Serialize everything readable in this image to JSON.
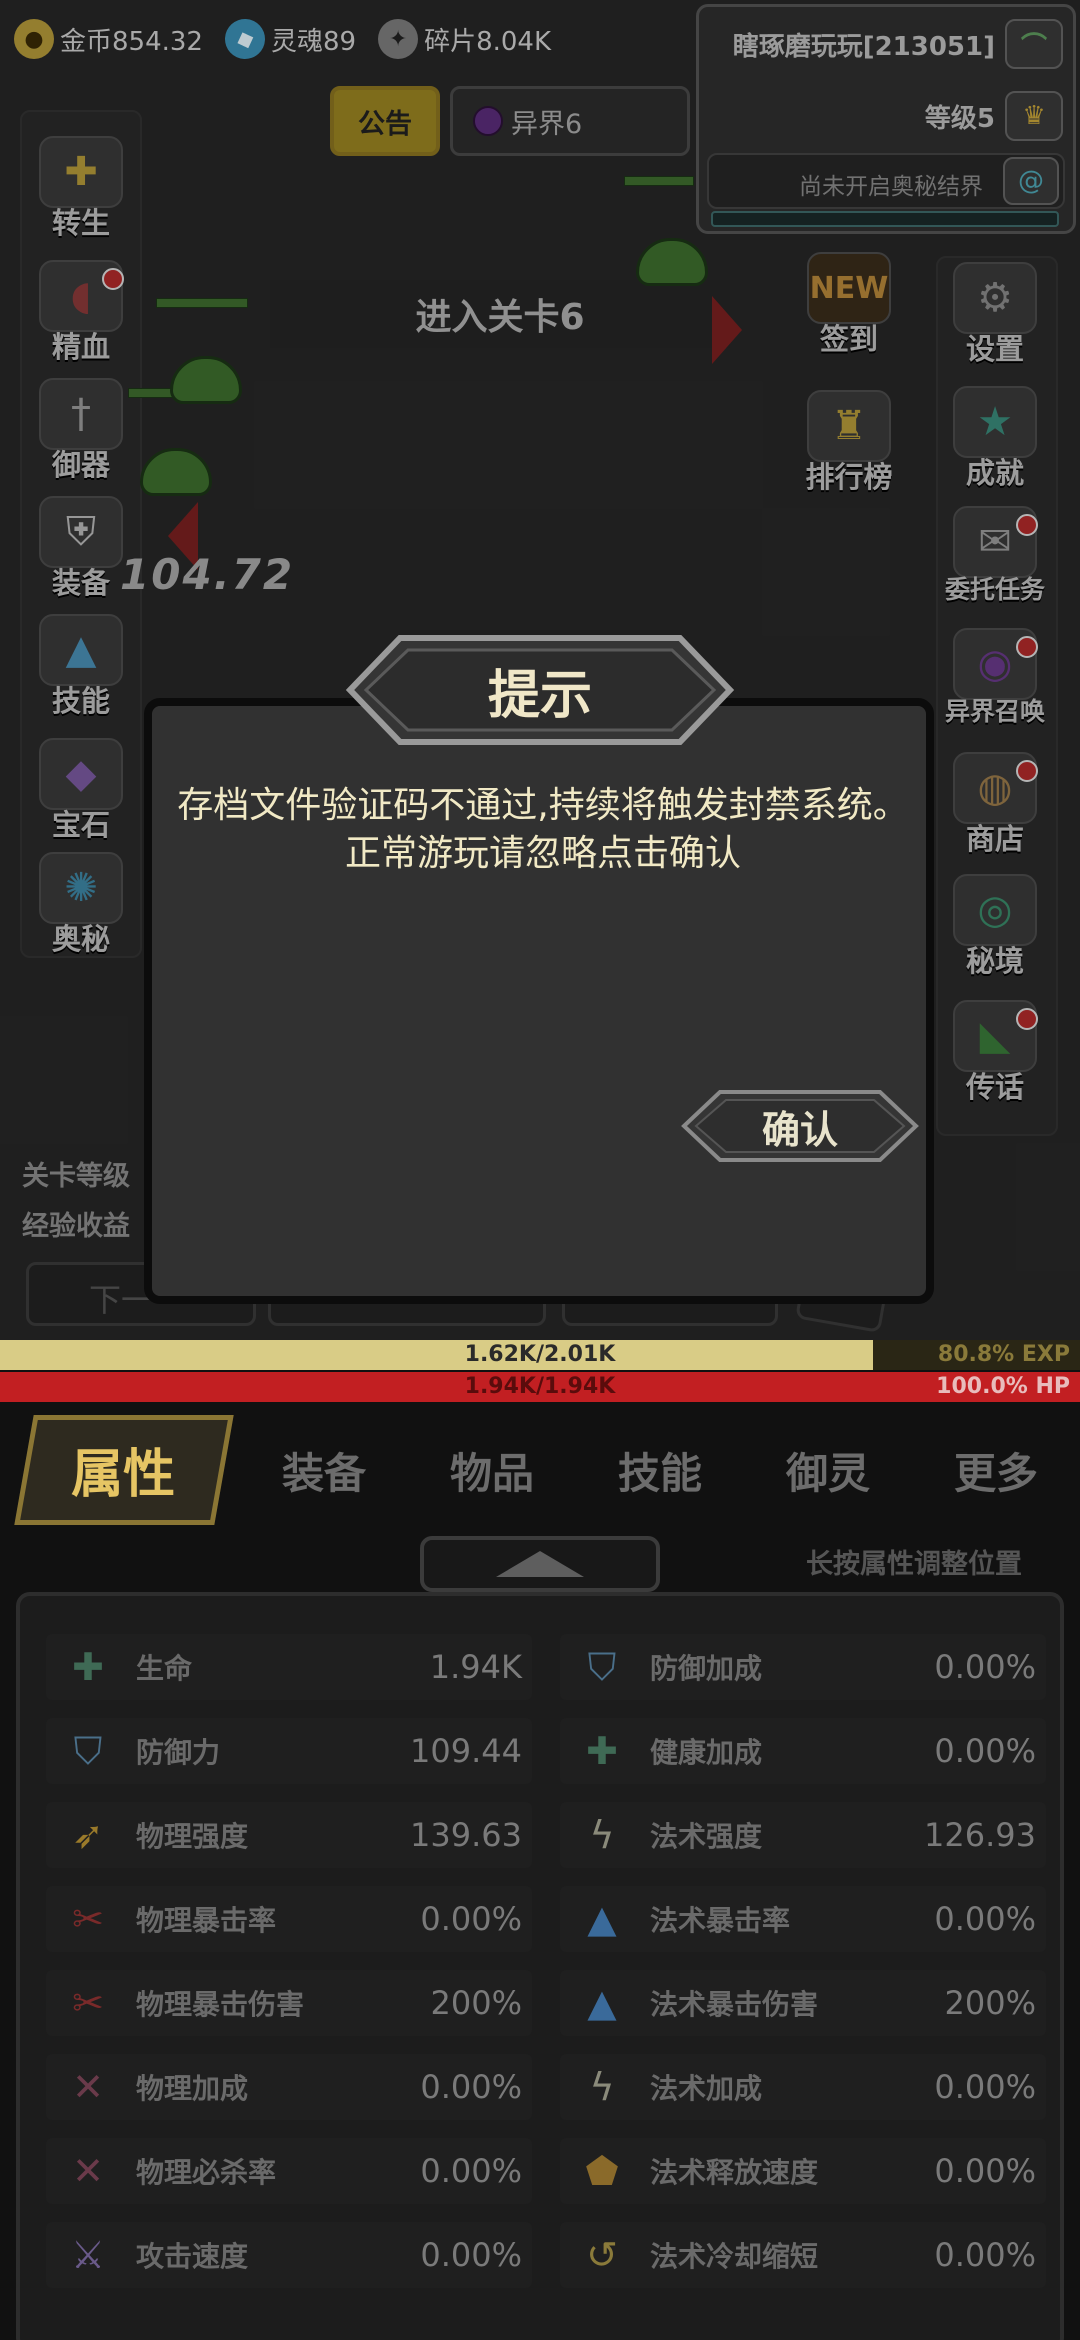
{
  "currencies": {
    "gold": "金币854.32",
    "soul": "灵魂89",
    "fragment": "碎片8.04K"
  },
  "player": {
    "name": "瞎琢磨玩玩[213051]",
    "level": "等级5",
    "secret_status": "尚未开启奥秘结界"
  },
  "top_tabs": {
    "notice": "公告",
    "world": "异界6"
  },
  "left_menu": [
    "转生",
    "精血",
    "御器",
    "装备",
    "技能",
    "宝石",
    "奥秘"
  ],
  "right_menu": [
    "设置",
    "成就",
    "委托任务",
    "异界召唤",
    "商店",
    "秘境",
    "传话"
  ],
  "center_buttons": {
    "sign_in_badge": "NEW",
    "sign_in": "签到",
    "leaderboard": "排行榜"
  },
  "stage": {
    "enter": "进入关卡6",
    "damage_text": "104.72"
  },
  "level_info": {
    "stage_level": "关卡等级",
    "exp_gain": "经验收益"
  },
  "partial_buttons": {
    "next": "下一"
  },
  "dialog": {
    "title": "提示",
    "message": "存档文件验证码不通过,持续将触发封禁系统。正常游玩请忽略点击确认",
    "confirm": "确认"
  },
  "exp_bar": {
    "text": "1.62K/2.01K",
    "percent": "80.8% EXP",
    "fraction": 0.808
  },
  "hp_bar": {
    "text": "1.94K/1.94K",
    "percent": "100.0%  HP",
    "fraction": 1.0
  },
  "bottom_tabs": [
    "属性",
    "装备",
    "物品",
    "技能",
    "御灵",
    "更多"
  ],
  "attr_hint": "长按属性调整位置",
  "attributes": [
    {
      "name": "生命",
      "value": "1.94K",
      "icon": "cross-icon"
    },
    {
      "name": "防御加成",
      "value": "0.00%",
      "icon": "shield-icon"
    },
    {
      "name": "防御力",
      "value": "109.44",
      "icon": "shield-icon"
    },
    {
      "name": "健康加成",
      "value": "0.00%",
      "icon": "cross-icon"
    },
    {
      "name": "物理强度",
      "value": "139.63",
      "icon": "sword-icon"
    },
    {
      "name": "法术强度",
      "value": "126.93",
      "icon": "lightning-icon"
    },
    {
      "name": "物理暴击率",
      "value": "0.00%",
      "icon": "claw-icon"
    },
    {
      "name": "法术暴击率",
      "value": "0.00%",
      "icon": "flame-icon"
    },
    {
      "name": "物理暴击伤害",
      "value": "200%",
      "icon": "claw-icon"
    },
    {
      "name": "法术暴击伤害",
      "value": "200%",
      "icon": "flame-icon"
    },
    {
      "name": "物理加成",
      "value": "0.00%",
      "icon": "cross-blades-icon"
    },
    {
      "name": "法术加成",
      "value": "0.00%",
      "icon": "lightning-icon"
    },
    {
      "name": "物理必杀率",
      "value": "0.00%",
      "icon": "cross-blades-icon"
    },
    {
      "name": "法术释放速度",
      "value": "0.00%",
      "icon": "shield-orange-icon"
    },
    {
      "name": "攻击速度",
      "value": "0.00%",
      "icon": "sword-purple-icon"
    },
    {
      "name": "法术冷却缩短",
      "value": "0.00%",
      "icon": "swirl-icon"
    }
  ],
  "colors": {
    "exp_fill": "#d9cc86",
    "hp_fill": "#c21f22",
    "accent_gold": "#e6c564",
    "dialog_text": "#f1e9c5"
  }
}
